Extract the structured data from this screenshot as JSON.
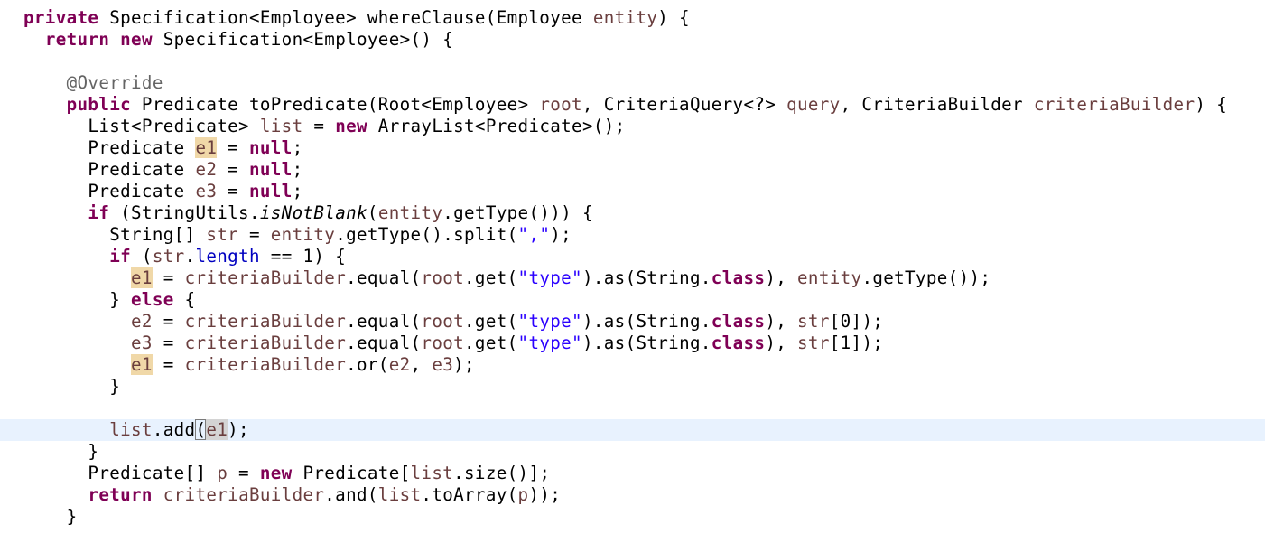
{
  "code": {
    "l1": {
      "kw1": "private",
      "t1": " Specification<Employee> whereClause(Employee ",
      "v1": "entity",
      "t2": ") {"
    },
    "l2": {
      "ind": "  ",
      "kw1": "return",
      "t1": " ",
      "kw2": "new",
      "t2": " Specification<Employee>() {"
    },
    "l3": {
      "t": ""
    },
    "l4": {
      "ind": "    ",
      "ann": "@Override"
    },
    "l5": {
      "ind": "    ",
      "kw1": "public",
      "t1": " Predicate toPredicate(Root<Employee> ",
      "v1": "root",
      "t2": ", CriteriaQuery<?> ",
      "v2": "query",
      "t3": ", CriteriaBuilder ",
      "v3": "criteriaBuilder",
      "t4": ") {"
    },
    "l6": {
      "ind": "      ",
      "t1": "List<Predicate> ",
      "v1": "list",
      "t2": " = ",
      "kw1": "new",
      "t3": " ArrayList<Predicate>();"
    },
    "l7": {
      "ind": "      ",
      "t1": "Predicate ",
      "v1": "e1",
      "t2": " = ",
      "kw1": "null",
      "t3": ";"
    },
    "l8": {
      "ind": "      ",
      "t1": "Predicate ",
      "v1": "e2",
      "t2": " = ",
      "kw1": "null",
      "t3": ";"
    },
    "l9": {
      "ind": "      ",
      "t1": "Predicate ",
      "v1": "e3",
      "t2": " = ",
      "kw1": "null",
      "t3": ";"
    },
    "l10": {
      "ind": "      ",
      "kw1": "if",
      "t1": " (StringUtils.",
      "m1": "isNotBlank",
      "t2": "(",
      "v1": "entity",
      "t3": ".getType())) {"
    },
    "l11": {
      "ind": "        ",
      "t1": "String[] ",
      "v1": "str",
      "t2": " = ",
      "v2": "entity",
      "t3": ".getType().split(",
      "s1": "\",\"",
      "t4": ");"
    },
    "l12": {
      "ind": "        ",
      "kw1": "if",
      "t1": " (",
      "v1": "str",
      "t2": ".",
      "f1": "length",
      "t3": " == 1) {"
    },
    "l13": {
      "ind": "          ",
      "v1": "e1",
      "t1": " = ",
      "v2": "criteriaBuilder",
      "t2": ".equal(",
      "v3": "root",
      "t3": ".get(",
      "s1": "\"type\"",
      "t4": ").as(String.",
      "kw1": "class",
      "t5": "), ",
      "v4": "entity",
      "t6": ".getType());"
    },
    "l14": {
      "ind": "        ",
      "t1": "} ",
      "kw1": "else",
      "t2": " {"
    },
    "l15": {
      "ind": "          ",
      "v1": "e2",
      "t1": " = ",
      "v2": "criteriaBuilder",
      "t2": ".equal(",
      "v3": "root",
      "t3": ".get(",
      "s1": "\"type\"",
      "t4": ").as(String.",
      "kw1": "class",
      "t5": "), ",
      "v4": "str",
      "t6": "[0]);"
    },
    "l16": {
      "ind": "          ",
      "v1": "e3",
      "t1": " = ",
      "v2": "criteriaBuilder",
      "t2": ".equal(",
      "v3": "root",
      "t3": ".get(",
      "s1": "\"type\"",
      "t4": ").as(String.",
      "kw1": "class",
      "t5": "), ",
      "v4": "str",
      "t6": "[1]);"
    },
    "l17": {
      "ind": "          ",
      "v1": "e1",
      "t1": " = ",
      "v2": "criteriaBuilder",
      "t2": ".or(",
      "v3": "e2",
      "t3": ", ",
      "v4": "e3",
      "t4": ");"
    },
    "l18": {
      "ind": "        ",
      "t1": "}"
    },
    "l19": {
      "t": ""
    },
    "l20": {
      "ind": "        ",
      "v1": "list",
      "t1": ".add",
      "b1": "(",
      "v2": "e1",
      "t2": ");"
    },
    "l21": {
      "ind": "      ",
      "t1": "}"
    },
    "l22": {
      "ind": "      ",
      "t1": "Predicate[] ",
      "v1": "p",
      "t2": " = ",
      "kw1": "new",
      "t3": " Predicate[",
      "v2": "list",
      "t4": ".size()];"
    },
    "l23": {
      "ind": "      ",
      "kw1": "return",
      "t1": " ",
      "v1": "criteriaBuilder",
      "t2": ".and(",
      "v2": "list",
      "t3": ".toArray(",
      "v3": "p",
      "t4": "));"
    },
    "l24": {
      "ind": "    ",
      "t1": "}"
    }
  },
  "colors": {
    "keyword": "#7f0055",
    "variable": "#6a3e3e",
    "field": "#0000c0",
    "string": "#2a00ff",
    "annotation": "#646464",
    "occurrence_highlight": "#f0d8a8",
    "current_line": "#e8f2fe"
  }
}
